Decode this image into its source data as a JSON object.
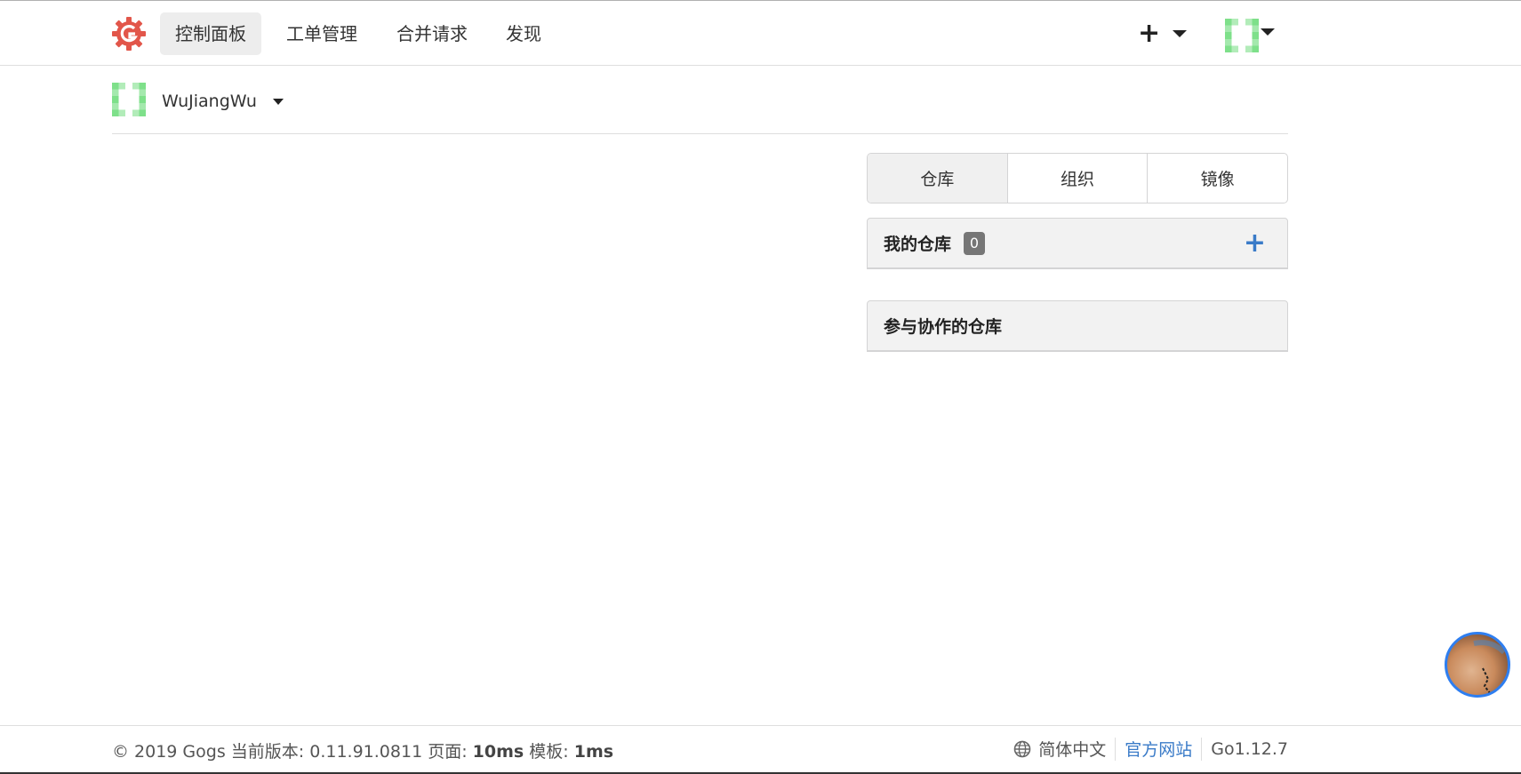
{
  "nav": {
    "logo_icon": "gogs-logo-icon",
    "items": [
      {
        "label": "控制面板",
        "active": true
      },
      {
        "label": "工单管理",
        "active": false
      },
      {
        "label": "合并请求",
        "active": false
      },
      {
        "label": "发现",
        "active": false
      }
    ],
    "create_icon": "plus-icon",
    "avatar_icon": "identicon-avatar"
  },
  "context": {
    "username": "WuJiangWu"
  },
  "tabs": [
    {
      "label": "仓库",
      "active": true
    },
    {
      "label": "组织",
      "active": false
    },
    {
      "label": "镜像",
      "active": false
    }
  ],
  "panels": {
    "my_repos": {
      "title": "我的仓库",
      "count": "0",
      "add_icon": "plus-icon"
    },
    "collab_repos": {
      "title": "参与协作的仓库"
    }
  },
  "footer": {
    "copyright": "© 2019 Gogs",
    "version_label": "当前版本:",
    "version": "0.11.91.0811",
    "page_label": "页面:",
    "page_time": "10ms",
    "template_label": "模板:",
    "template_time": "1ms",
    "language": "简体中文",
    "website": "官方网站",
    "go_version": "Go1.12.7"
  },
  "colors": {
    "accent": "#3a7bc8",
    "logo": "#e2564a",
    "identicon": "#7ee08a"
  }
}
